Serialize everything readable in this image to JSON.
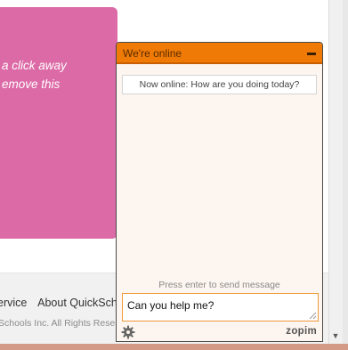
{
  "page": {
    "promo_lines": [
      "a click away",
      "emove this"
    ],
    "footer_links": [
      "ervice",
      "About QuickSch"
    ],
    "footer_copyright": "Schools Inc. All Rights Rese"
  },
  "chat": {
    "title": "We're online",
    "minimize_icon": "minimize-icon",
    "status_message": "Now online: How are you doing today?",
    "input_hint": "Press enter to send message",
    "input_value": "Can you help me?",
    "settings_icon": "gear-icon",
    "brand": "zopim"
  },
  "colors": {
    "header": "#f07a06",
    "promo": "#dc6aa6",
    "chat_background": "#fdf5ef"
  }
}
